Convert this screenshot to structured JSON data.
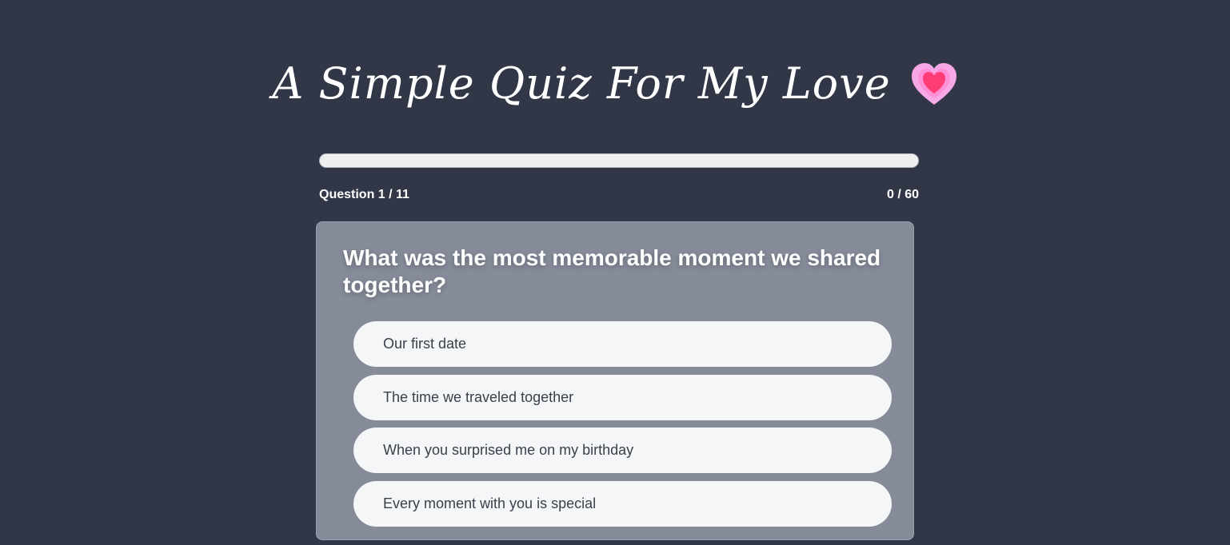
{
  "header": {
    "title": "A Simple Quiz For My Love",
    "heart_icon": "pink-heart-icon"
  },
  "progress": {
    "fraction": 0,
    "question_label": "Question 1 / 11",
    "score_label": "0 / 60"
  },
  "quiz": {
    "question": "What was the most memorable moment we shared together?",
    "options": [
      {
        "label": "Our first date"
      },
      {
        "label": "The time we traveled together"
      },
      {
        "label": "When you surprised me on my birthday"
      },
      {
        "label": "Every moment with you is special"
      }
    ]
  },
  "colors": {
    "background": "#313747",
    "card": "#868b9a",
    "option": "#f4f6f8",
    "heart_outer": "#f7a8e6",
    "heart_inner": "#ff3d75"
  }
}
